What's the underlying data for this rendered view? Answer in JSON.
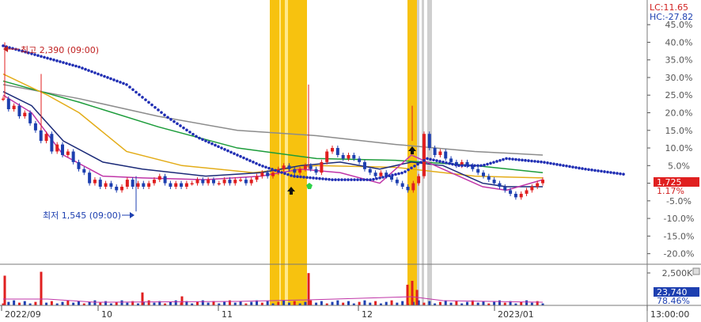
{
  "chart_data": {
    "type": "candlestick",
    "price_axis": {
      "ticks": [
        45,
        40,
        35,
        30,
        25,
        20,
        15,
        10,
        5,
        0,
        -5,
        -10,
        -15,
        -20
      ],
      "tick_labels": [
        "45.0%",
        "40.0%",
        "35.0%",
        "30.0%",
        "25.0%",
        "20.0%",
        "15.0%",
        "10.0%",
        "5.0%",
        "0.0%",
        "-5.0%",
        "-10.0%",
        "-15.0%",
        "-20.0%"
      ],
      "ylim": [
        -23,
        52
      ]
    },
    "volume_axis": {
      "tick_label": "2,500K",
      "ylim": [
        0,
        3000
      ]
    },
    "x_axis": {
      "labels": [
        "2022/09",
        "10",
        "11",
        "12",
        "2023/01",
        "13:00:00"
      ]
    },
    "corner_labels": {
      "lc": "LC:11.65",
      "hc": "HC:-27.82"
    },
    "annotations": {
      "high": "최고 2,390 (09:00)",
      "low": "최저 1,545 (09:00)"
    },
    "current": {
      "price_tag": "1,725",
      "change": "1.17%",
      "volume_tag": "23,740",
      "volume_pct": "78.46%"
    },
    "candles_y": [
      24,
      21,
      22,
      19,
      20,
      17,
      15,
      12,
      14,
      9,
      11,
      8,
      9,
      6,
      4,
      3,
      0,
      1,
      -1,
      0,
      -1,
      -2,
      -1,
      1,
      -1,
      0,
      -1,
      0,
      1,
      2,
      0,
      -1,
      0,
      -1,
      0,
      0,
      1,
      0,
      1,
      0,
      0,
      1,
      0,
      1,
      1,
      0,
      1,
      2,
      3,
      2,
      3,
      4,
      5,
      4,
      3,
      4,
      5,
      4,
      3,
      6,
      9,
      10,
      8,
      7,
      8,
      7,
      6,
      4,
      3,
      2,
      3,
      2,
      1,
      0,
      -1,
      -2,
      0,
      2,
      14,
      10,
      8,
      9,
      7,
      6,
      5,
      6,
      5,
      4,
      3,
      2,
      1,
      0,
      -1,
      -2,
      -3,
      -4,
      -3,
      -2,
      -1,
      0,
      1
    ]
  },
  "colors": {
    "up": "#e01f1f",
    "down": "#1d3fb0",
    "highlight": "#f7c20f",
    "ma_gray": "#8c8c8c",
    "ma_green": "#1c9c3a",
    "ma_gold": "#e3ac17",
    "ma_navy": "#1b2a78",
    "ma_magenta": "#c035a8",
    "dots": "#1f2db3"
  },
  "icons": [
    "arrow-up-icon",
    "arrow-right-icon",
    "arrow-left-icon",
    "pentagon-marker-icon"
  ]
}
